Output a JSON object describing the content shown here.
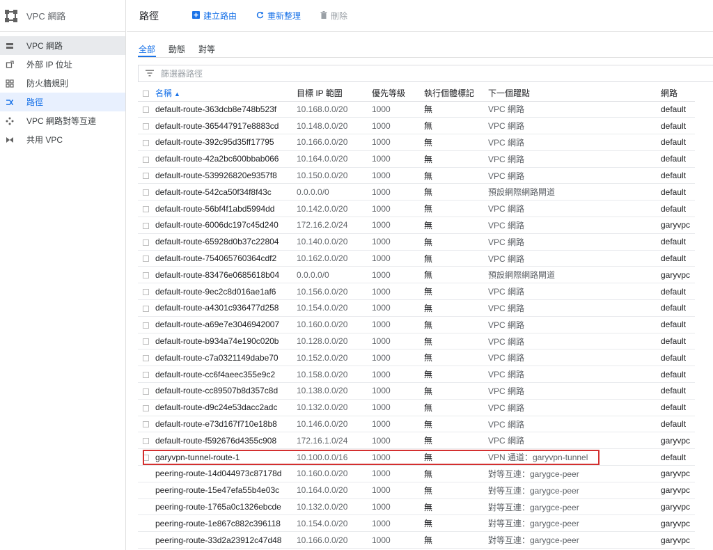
{
  "sidebar": {
    "title": "VPC 網路",
    "items": [
      {
        "label": "VPC 網路",
        "icon": "vpc-network-icon"
      },
      {
        "label": "外部 IP 位址",
        "icon": "external-ip-icon"
      },
      {
        "label": "防火牆規則",
        "icon": "firewall-icon"
      },
      {
        "label": "路徑",
        "icon": "routes-icon"
      },
      {
        "label": "VPC 網路對等互連",
        "icon": "peering-icon"
      },
      {
        "label": "共用 VPC",
        "icon": "shared-vpc-icon"
      }
    ]
  },
  "topbar": {
    "title": "路徑",
    "create_label": "建立路由",
    "refresh_label": "重新整理",
    "delete_label": "刪除"
  },
  "tabs": [
    "全部",
    "動態",
    "對等"
  ],
  "filter": {
    "placeholder": "篩選器路徑"
  },
  "table": {
    "headers": {
      "name": "名稱",
      "range": "目標 IP 範圍",
      "priority": "優先等級",
      "tags": "執行個體標記",
      "next_hop": "下一個躍點",
      "network": "網路"
    },
    "rows": [
      {
        "name": "default-route-363dcb8e748b523f",
        "range": "10.168.0.0/20",
        "priority": "1000",
        "tags": "無",
        "next_hop": "VPC 網路",
        "network": "default",
        "checkbox": true
      },
      {
        "name": "default-route-365447917e8883cd",
        "range": "10.148.0.0/20",
        "priority": "1000",
        "tags": "無",
        "next_hop": "VPC 網路",
        "network": "default",
        "checkbox": true
      },
      {
        "name": "default-route-392c95d35ff17795",
        "range": "10.166.0.0/20",
        "priority": "1000",
        "tags": "無",
        "next_hop": "VPC 網路",
        "network": "default",
        "checkbox": true
      },
      {
        "name": "default-route-42a2bc600bbab066",
        "range": "10.164.0.0/20",
        "priority": "1000",
        "tags": "無",
        "next_hop": "VPC 網路",
        "network": "default",
        "checkbox": true
      },
      {
        "name": "default-route-539926820e9357f8",
        "range": "10.150.0.0/20",
        "priority": "1000",
        "tags": "無",
        "next_hop": "VPC 網路",
        "network": "default",
        "checkbox": true
      },
      {
        "name": "default-route-542ca50f34f8f43c",
        "range": "0.0.0.0/0",
        "priority": "1000",
        "tags": "無",
        "next_hop": "預設網際網路閘道",
        "network": "default",
        "checkbox": true
      },
      {
        "name": "default-route-56bf4f1abd5994dd",
        "range": "10.142.0.0/20",
        "priority": "1000",
        "tags": "無",
        "next_hop": "VPC 網路",
        "network": "default",
        "checkbox": true
      },
      {
        "name": "default-route-6006dc197c45d240",
        "range": "172.16.2.0/24",
        "priority": "1000",
        "tags": "無",
        "next_hop": "VPC 網路",
        "network": "garyvpc",
        "checkbox": true
      },
      {
        "name": "default-route-65928d0b37c22804",
        "range": "10.140.0.0/20",
        "priority": "1000",
        "tags": "無",
        "next_hop": "VPC 網路",
        "network": "default",
        "checkbox": true
      },
      {
        "name": "default-route-754065760364cdf2",
        "range": "10.162.0.0/20",
        "priority": "1000",
        "tags": "無",
        "next_hop": "VPC 網路",
        "network": "default",
        "checkbox": true
      },
      {
        "name": "default-route-83476e0685618b04",
        "range": "0.0.0.0/0",
        "priority": "1000",
        "tags": "無",
        "next_hop": "預設網際網路閘道",
        "network": "garyvpc",
        "checkbox": true
      },
      {
        "name": "default-route-9ec2c8d016ae1af6",
        "range": "10.156.0.0/20",
        "priority": "1000",
        "tags": "無",
        "next_hop": "VPC 網路",
        "network": "default",
        "checkbox": true
      },
      {
        "name": "default-route-a4301c936477d258",
        "range": "10.154.0.0/20",
        "priority": "1000",
        "tags": "無",
        "next_hop": "VPC 網路",
        "network": "default",
        "checkbox": true
      },
      {
        "name": "default-route-a69e7e3046942007",
        "range": "10.160.0.0/20",
        "priority": "1000",
        "tags": "無",
        "next_hop": "VPC 網路",
        "network": "default",
        "checkbox": true
      },
      {
        "name": "default-route-b934a74e190c020b",
        "range": "10.128.0.0/20",
        "priority": "1000",
        "tags": "無",
        "next_hop": "VPC 網路",
        "network": "default",
        "checkbox": true
      },
      {
        "name": "default-route-c7a0321149dabe70",
        "range": "10.152.0.0/20",
        "priority": "1000",
        "tags": "無",
        "next_hop": "VPC 網路",
        "network": "default",
        "checkbox": true
      },
      {
        "name": "default-route-cc6f4aeec355e9c2",
        "range": "10.158.0.0/20",
        "priority": "1000",
        "tags": "無",
        "next_hop": "VPC 網路",
        "network": "default",
        "checkbox": true
      },
      {
        "name": "default-route-cc89507b8d357c8d",
        "range": "10.138.0.0/20",
        "priority": "1000",
        "tags": "無",
        "next_hop": "VPC 網路",
        "network": "default",
        "checkbox": true
      },
      {
        "name": "default-route-d9c24e53dacc2adc",
        "range": "10.132.0.0/20",
        "priority": "1000",
        "tags": "無",
        "next_hop": "VPC 網路",
        "network": "default",
        "checkbox": true
      },
      {
        "name": "default-route-e73d167f710e18b8",
        "range": "10.146.0.0/20",
        "priority": "1000",
        "tags": "無",
        "next_hop": "VPC 網路",
        "network": "default",
        "checkbox": true
      },
      {
        "name": "default-route-f592676d4355c908",
        "range": "172.16.1.0/24",
        "priority": "1000",
        "tags": "無",
        "next_hop": "VPC 網路",
        "network": "garyvpc",
        "checkbox": true
      },
      {
        "name": "garyvpn-tunnel-route-1",
        "range": "10.100.0.0/16",
        "priority": "1000",
        "tags": "無",
        "next_hop": "VPN 通道：garyvpn-tunnel",
        "network": "default",
        "checkbox": true
      },
      {
        "name": "peering-route-14d044973c87178d",
        "range": "10.160.0.0/20",
        "priority": "1000",
        "tags": "無",
        "next_hop": "對等互連：garygce-peer",
        "network": "garyvpc",
        "checkbox": false
      },
      {
        "name": "peering-route-15e47efa55b4e03c",
        "range": "10.164.0.0/20",
        "priority": "1000",
        "tags": "無",
        "next_hop": "對等互連：garygce-peer",
        "network": "garyvpc",
        "checkbox": false
      },
      {
        "name": "peering-route-1765a0c1326ebcde",
        "range": "10.132.0.0/20",
        "priority": "1000",
        "tags": "無",
        "next_hop": "對等互連：garygce-peer",
        "network": "garyvpc",
        "checkbox": false
      },
      {
        "name": "peering-route-1e867c882c396118",
        "range": "10.154.0.0/20",
        "priority": "1000",
        "tags": "無",
        "next_hop": "對等互連：garygce-peer",
        "network": "garyvpc",
        "checkbox": false
      },
      {
        "name": "peering-route-33d2a23912c47d48",
        "range": "10.166.0.0/20",
        "priority": "1000",
        "tags": "無",
        "next_hop": "對等互連：garygce-peer",
        "network": "garyvpc",
        "checkbox": false
      }
    ]
  },
  "colors": {
    "accent": "#1a73e8",
    "highlight": "#d32f2f",
    "active_bg": "#e8f0fe"
  }
}
